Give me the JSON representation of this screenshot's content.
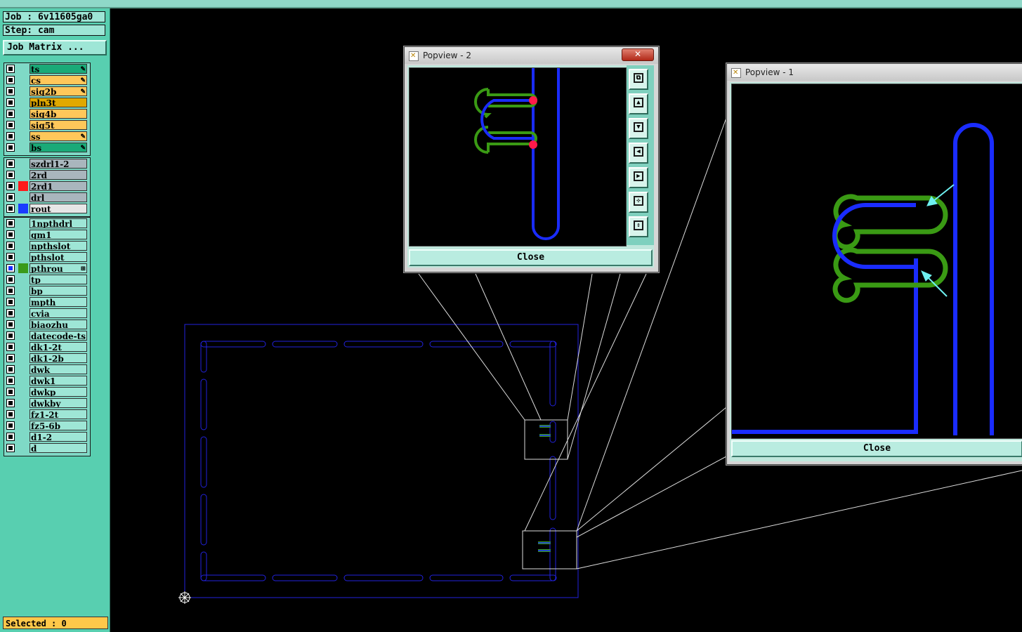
{
  "job": {
    "label": "Job : 6v11605ga0",
    "step": "Step: cam",
    "matrix_button": "Job Matrix ..."
  },
  "layer_groups": [
    [
      {
        "name": "ts",
        "color": "#1aaa78",
        "swatch": "",
        "mark": "✎"
      },
      {
        "name": "cs",
        "color": "#ffc75a",
        "swatch": "",
        "mark": "✎"
      },
      {
        "name": "sig2b",
        "color": "#ffc75a",
        "swatch": "",
        "mark": "✎"
      },
      {
        "name": "pln3t",
        "color": "#e0a800",
        "swatch": "",
        "mark": ""
      },
      {
        "name": "sig4b",
        "color": "#ffc75a",
        "swatch": "",
        "mark": ""
      },
      {
        "name": "sig5t",
        "color": "#ffc75a",
        "swatch": "",
        "mark": ""
      },
      {
        "name": "ss",
        "color": "#ffc75a",
        "swatch": "",
        "mark": "✎"
      },
      {
        "name": "bs",
        "color": "#1aaa78",
        "swatch": "",
        "mark": "✎"
      }
    ],
    [
      {
        "name": "szdrl1-2",
        "color": "#a9b6bd",
        "swatch": "",
        "mark": ""
      },
      {
        "name": "2rd",
        "color": "#a9b6bd",
        "swatch": "",
        "mark": ""
      },
      {
        "name": "2rd1",
        "color": "#a9b6bd",
        "swatch": "#ff1a1a",
        "mark": ""
      },
      {
        "name": "drl",
        "color": "#a9b6bd",
        "swatch": "",
        "mark": ""
      },
      {
        "name": "rout",
        "color": "#e6e6e6",
        "swatch": "#1a3cff",
        "mark": ""
      }
    ],
    [
      {
        "name": "1npthdrl",
        "color": "#9ee6d6",
        "swatch": "",
        "mark": ""
      },
      {
        "name": "gm1",
        "color": "#9ee6d6",
        "swatch": "",
        "mark": ""
      },
      {
        "name": "npthslot",
        "color": "#9ee6d6",
        "swatch": "",
        "mark": ""
      },
      {
        "name": "pthslot",
        "color": "#9ee6d6",
        "swatch": "",
        "mark": ""
      },
      {
        "name": "pthrou",
        "color": "#9ee6d6",
        "swatch": "#3a9a1a",
        "mark": "⊞",
        "checked": true
      },
      {
        "name": "tp",
        "color": "#9ee6d6",
        "swatch": "",
        "mark": ""
      },
      {
        "name": "bp",
        "color": "#9ee6d6",
        "swatch": "",
        "mark": ""
      },
      {
        "name": "mpth",
        "color": "#9ee6d6",
        "swatch": "",
        "mark": ""
      },
      {
        "name": "cvia",
        "color": "#9ee6d6",
        "swatch": "",
        "mark": ""
      },
      {
        "name": "biaozhu",
        "color": "#9ee6d6",
        "swatch": "",
        "mark": ""
      },
      {
        "name": "datecode-ts",
        "color": "#9ee6d6",
        "swatch": "",
        "mark": ""
      },
      {
        "name": "dk1-2t",
        "color": "#9ee6d6",
        "swatch": "",
        "mark": ""
      },
      {
        "name": "dk1-2b",
        "color": "#9ee6d6",
        "swatch": "",
        "mark": ""
      },
      {
        "name": "dwk",
        "color": "#9ee6d6",
        "swatch": "",
        "mark": ""
      },
      {
        "name": "dwk1",
        "color": "#9ee6d6",
        "swatch": "",
        "mark": ""
      },
      {
        "name": "dwkp",
        "color": "#9ee6d6",
        "swatch": "",
        "mark": ""
      },
      {
        "name": "dwkby",
        "color": "#9ee6d6",
        "swatch": "",
        "mark": ""
      },
      {
        "name": "fz1-2t",
        "color": "#9ee6d6",
        "swatch": "",
        "mark": ""
      },
      {
        "name": "fz5-6b",
        "color": "#9ee6d6",
        "swatch": "",
        "mark": ""
      },
      {
        "name": "d1-2",
        "color": "#9ee6d6",
        "swatch": "",
        "mark": ""
      },
      {
        "name": "d",
        "color": "#9ee6d6",
        "swatch": "",
        "mark": ""
      }
    ]
  ],
  "status": {
    "selected": "Selected : 0"
  },
  "popview2": {
    "title": "Popview - 2",
    "close_x": "✕",
    "close_label": "Close",
    "tools": [
      "zoom-window-icon",
      "pan-up-icon",
      "pan-down-icon",
      "pan-left-icon",
      "pan-right-icon",
      "zoom-fit-icon",
      "zoom-home-icon"
    ]
  },
  "popview1": {
    "title": "Popview - 1",
    "close_label": "Close"
  },
  "colors": {
    "rout": "#1a2cff",
    "route_outline": "#2222dd",
    "pthrou": "#3a9a14",
    "highlight": "#ff1a4a",
    "arrow": "#6ef0f0",
    "panel": "#58cfb0"
  }
}
